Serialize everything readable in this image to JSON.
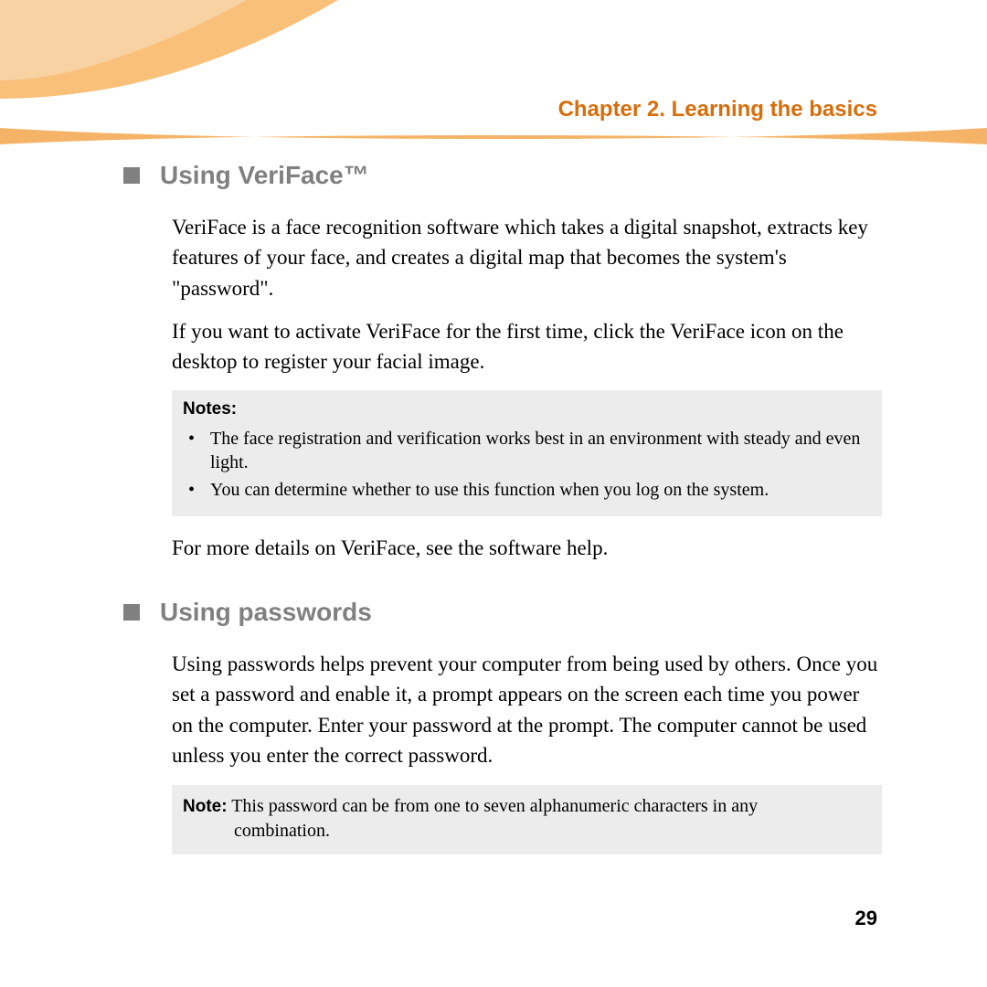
{
  "chapter_title": "Chapter 2. Learning the basics",
  "section1": {
    "title": "Using VeriFace™",
    "para1": "VeriFace is a face recognition software which takes a digital snapshot, extracts key features of your face, and creates a digital map that becomes the system's \"password\".",
    "para2": "If you want to activate VeriFace for the first time, click the VeriFace icon on the desktop to register your facial image.",
    "notes_label": "Notes:",
    "note_items": [
      "The face registration and verification works best in an environment with steady and even light.",
      "You can determine whether to use this function when you log on the system."
    ],
    "para3": "For more details on VeriFace, see the software help."
  },
  "section2": {
    "title": "Using passwords",
    "para1": "Using passwords helps prevent your computer from being used by others. Once you set a password and enable it, a prompt appears on the screen each time you power on the computer. Enter your password at the prompt. The computer cannot be used unless you enter the correct password.",
    "note_label": "Note:",
    "note_text_line1": "This password can be from one to seven alphanumeric characters in any",
    "note_text_line2": "combination."
  },
  "page_number": "29"
}
